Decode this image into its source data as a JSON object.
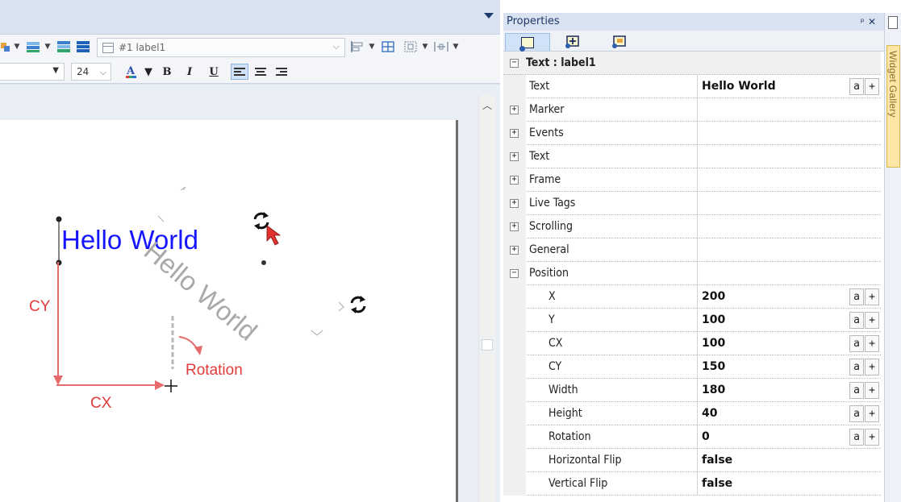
{
  "editor": {
    "object_selector": {
      "value": "#1 label1"
    },
    "font_size": "24",
    "canvas": {
      "label_text": "Hello World",
      "rotated_label_text": "Hello World",
      "annotations": {
        "cy": "CY",
        "cx": "CX",
        "rotation": "Rotation"
      }
    }
  },
  "properties": {
    "title": "Properties",
    "object_header": "Text : label1",
    "rows": [
      {
        "name": "Text",
        "value": "Hello World",
        "kind": "prop",
        "buttons": true
      },
      {
        "name": "Marker",
        "value": "",
        "kind": "cat"
      },
      {
        "name": "Events",
        "value": "",
        "kind": "cat"
      },
      {
        "name": "Text",
        "value": "",
        "kind": "cat"
      },
      {
        "name": "Frame",
        "value": "",
        "kind": "cat"
      },
      {
        "name": "Live Tags",
        "value": "",
        "kind": "cat"
      },
      {
        "name": "Scrolling",
        "value": "",
        "kind": "cat"
      },
      {
        "name": "General",
        "value": "",
        "kind": "cat"
      },
      {
        "name": "Position",
        "value": "",
        "kind": "cat-open"
      },
      {
        "name": "X",
        "value": "200",
        "kind": "sub",
        "buttons": true
      },
      {
        "name": "Y",
        "value": "100",
        "kind": "sub",
        "buttons": true
      },
      {
        "name": "CX",
        "value": "100",
        "kind": "sub",
        "buttons": true
      },
      {
        "name": "CY",
        "value": "150",
        "kind": "sub",
        "buttons": true
      },
      {
        "name": "Width",
        "value": "180",
        "kind": "sub",
        "buttons": true
      },
      {
        "name": "Height",
        "value": "40",
        "kind": "sub",
        "buttons": true
      },
      {
        "name": "Rotation",
        "value": "0",
        "kind": "sub",
        "buttons": true
      },
      {
        "name": "Horizontal Flip",
        "value": "false",
        "kind": "sub"
      },
      {
        "name": "Vertical Flip",
        "value": "false",
        "kind": "sub"
      }
    ],
    "row_buttons": {
      "attach": "a",
      "add": "+"
    },
    "expand_glyph": "+",
    "collapse_glyph": "−"
  },
  "side_panel": {
    "label": "Widget Gallery"
  },
  "colors": {
    "label_blue": "#1515ff",
    "annotation_red": "#e23a3a",
    "rotated_grey": "#a9a9a9",
    "accent_tab": "#cfe2f8"
  },
  "icons": [
    "dropdown-arrow-icon",
    "layer-icon",
    "frame-icon",
    "align-icon",
    "font-color-icon",
    "bold-icon",
    "italic-icon",
    "underline-icon",
    "align-left-icon",
    "align-center-icon",
    "align-right-icon",
    "rotate-icon",
    "pin-icon",
    "close-icon"
  ]
}
